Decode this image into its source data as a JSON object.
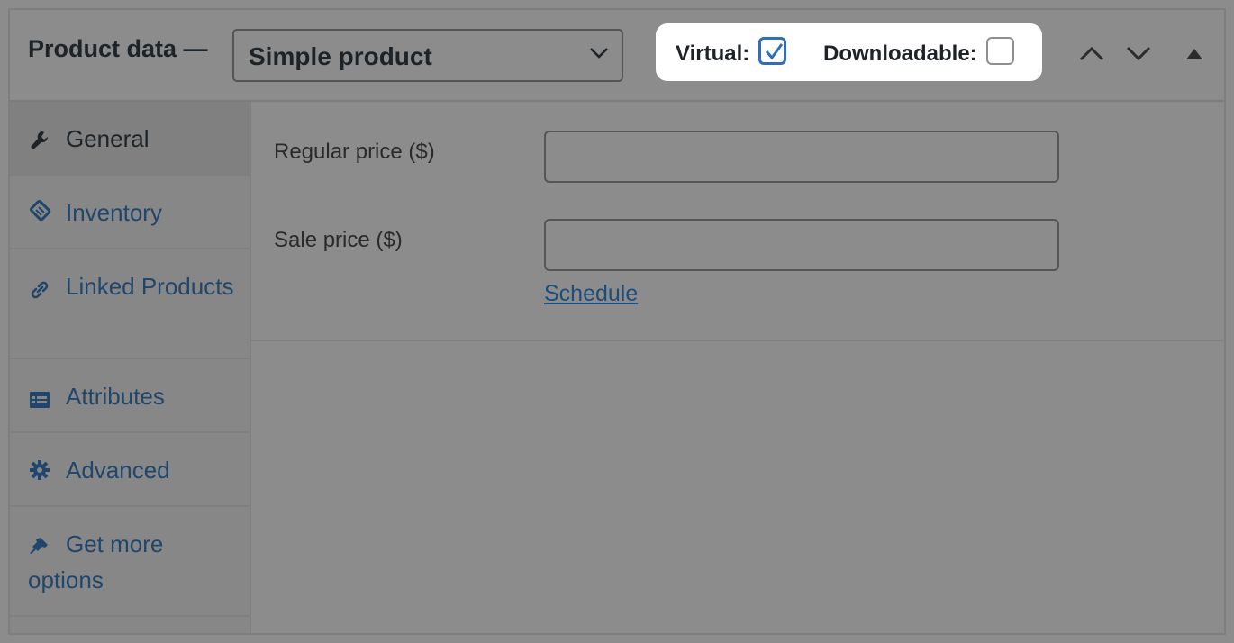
{
  "header": {
    "title": "Product data —",
    "product_type": "Simple product",
    "virtual_label": "Virtual:",
    "virtual_checked": true,
    "downloadable_label": "Downloadable:",
    "downloadable_checked": false,
    "icons": [
      "chevron-up-icon",
      "chevron-down-icon",
      "collapse-triangle-icon"
    ]
  },
  "sidebar": {
    "items": [
      {
        "label": "General",
        "icon": "wrench-icon",
        "active": true
      },
      {
        "label": "Inventory",
        "icon": "tag-icon",
        "active": false
      },
      {
        "label": "Linked Products",
        "icon": "link-icon",
        "active": false
      },
      {
        "label": "Attributes",
        "icon": "list-icon",
        "active": false
      },
      {
        "label": "Advanced",
        "icon": "gear-icon",
        "active": false
      },
      {
        "label": "Get more options",
        "icon": "plug-icon",
        "active": false
      }
    ]
  },
  "general": {
    "regular_price_label": "Regular price ($)",
    "regular_price_value": "",
    "sale_price_label": "Sale price ($)",
    "sale_price_value": "",
    "schedule_link": "Schedule"
  },
  "colors": {
    "background_dim": "#8c8c8c",
    "highlight": "#ffffff",
    "checkbox_accent": "#2f6ebd",
    "link": "#20466b"
  }
}
